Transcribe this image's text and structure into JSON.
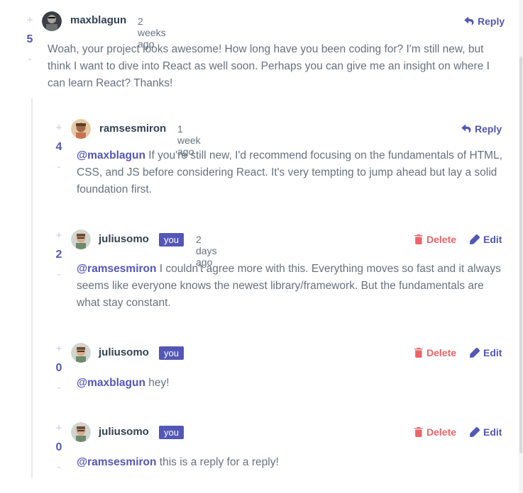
{
  "colors": {
    "accent": "#5357b6",
    "danger": "#ed6368",
    "text": "#67727e",
    "name": "#334253"
  },
  "labels": {
    "reply": "Reply",
    "delete": "Delete",
    "edit": "Edit",
    "you": "you",
    "plus": "+",
    "minus": "-"
  },
  "comments": [
    {
      "score": "5",
      "username": "maxblagun",
      "time": "2 weeks ago",
      "mention": "",
      "text": "Woah, your project looks awesome! How long have you been coding for? I'm still new, but think I want to dive into React as well soon. Perhaps you can give me an insight on where I can learn React? Thanks!"
    },
    {
      "score": "4",
      "username": "ramsesmiron",
      "time": "1 week ago",
      "mention": "@maxblagun",
      "text": "If you're still new, I'd recommend focusing on the fundamentals of HTML, CSS, and JS before considering React. It's very tempting to jump ahead but lay a solid foundation first."
    },
    {
      "score": "2",
      "username": "juliusomo",
      "time": "2 days ago",
      "mention": "@ramsesmiron",
      "text": "I couldn't agree more with this. Everything moves so fast and it always seems like everyone knows the newest library/framework. But the fundamentals are what stay constant."
    },
    {
      "score": "0",
      "username": "juliusomo",
      "time": "",
      "mention": "@maxblagun",
      "text": "hey!"
    },
    {
      "score": "0",
      "username": "juliusomo",
      "time": "",
      "mention": "@ramsesmiron",
      "text": "this is a reply for a reply!"
    }
  ]
}
